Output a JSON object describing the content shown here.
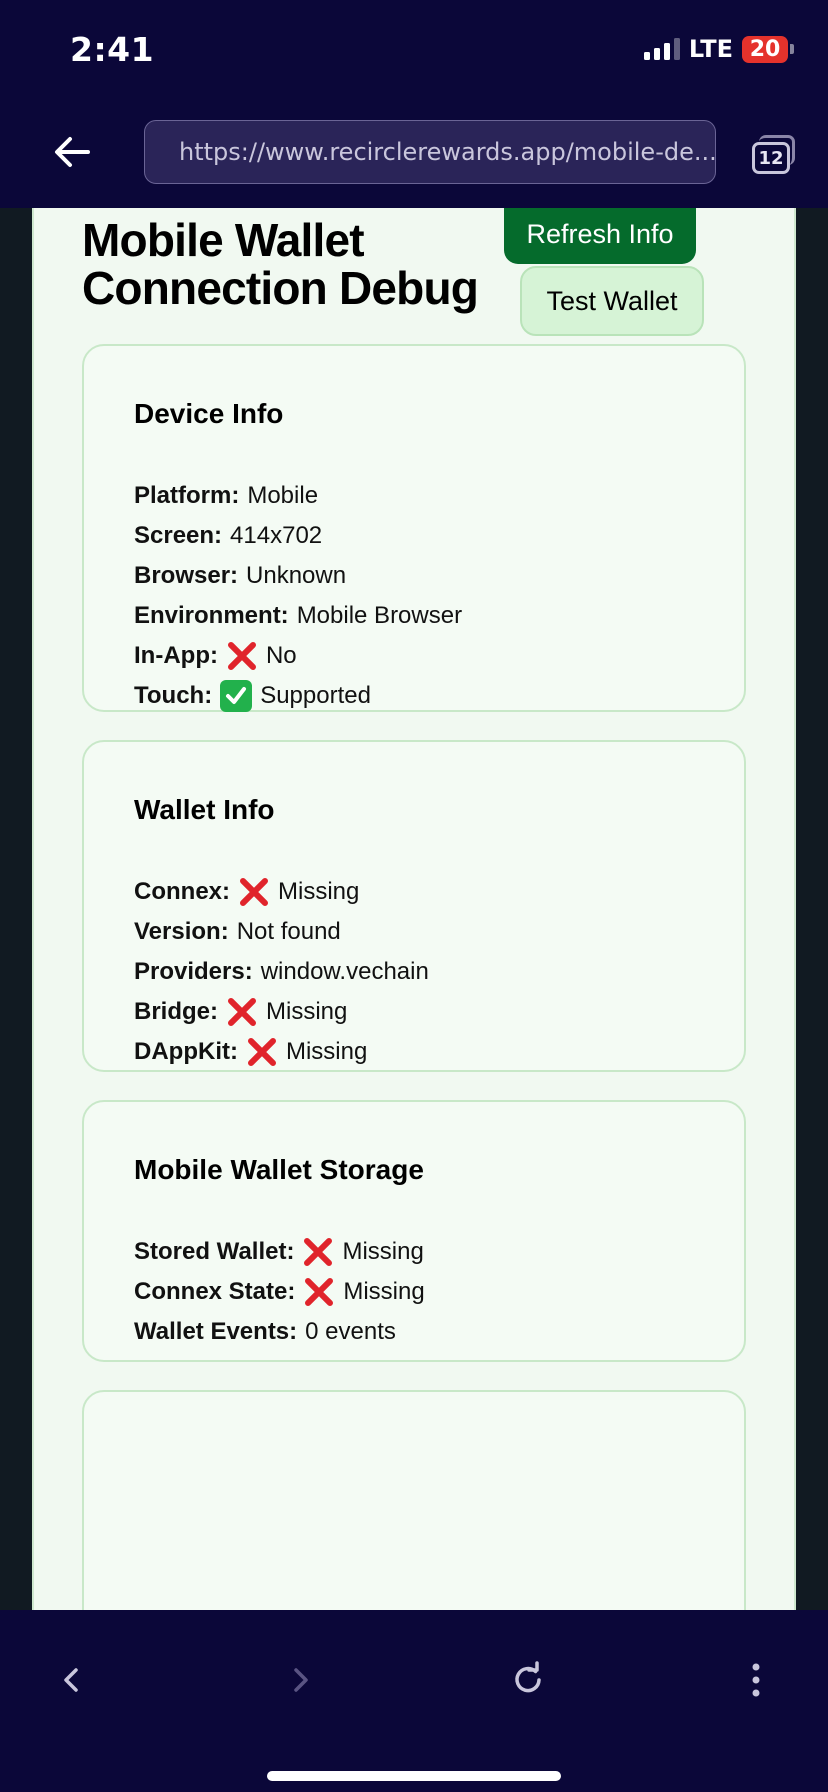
{
  "status_bar": {
    "time": "2:41",
    "network": "LTE",
    "battery": "20",
    "battery_color": "#e5322c"
  },
  "browser": {
    "url": "https://www.recirclerewards.app/mobile-de...",
    "tab_count": "12",
    "back_icon": "arrow-left-icon",
    "toolbar_icons": [
      "chevron-left-icon",
      "chevron-right-icon",
      "reload-icon",
      "more-vertical-icon"
    ]
  },
  "page": {
    "title": "Mobile Wallet Connection Debug",
    "refresh_button": "Refresh Info",
    "test_button": "Test Wallet",
    "accent_color": "#056b2c"
  },
  "device_info": {
    "title": "Device Info",
    "rows": [
      {
        "label": "Platform:",
        "value": "Mobile"
      },
      {
        "label": "Screen:",
        "value": "414x702"
      },
      {
        "label": "Browser:",
        "value": "Unknown"
      },
      {
        "label": "Environment:",
        "value": "Mobile Browser"
      },
      {
        "label": "In-App:",
        "value": "No",
        "icon": "cross-mark-icon"
      },
      {
        "label": "Touch:",
        "value": "Supported",
        "icon": "check-mark-icon"
      }
    ]
  },
  "wallet_info": {
    "title": "Wallet Info",
    "rows": [
      {
        "label": "Connex:",
        "value": "Missing",
        "icon": "cross-mark-icon"
      },
      {
        "label": "Version:",
        "value": "Not found"
      },
      {
        "label": "Providers:",
        "value": "window.vechain"
      },
      {
        "label": "Bridge:",
        "value": "Missing",
        "icon": "cross-mark-icon"
      },
      {
        "label": "DAppKit:",
        "value": "Missing",
        "icon": "cross-mark-icon"
      }
    ]
  },
  "storage_info": {
    "title": "Mobile Wallet Storage",
    "rows": [
      {
        "label": "Stored Wallet:",
        "value": "Missing",
        "icon": "cross-mark-icon"
      },
      {
        "label": "Connex State:",
        "value": "Missing",
        "icon": "cross-mark-icon"
      },
      {
        "label": "Wallet Events:",
        "value": "0 events"
      }
    ]
  }
}
